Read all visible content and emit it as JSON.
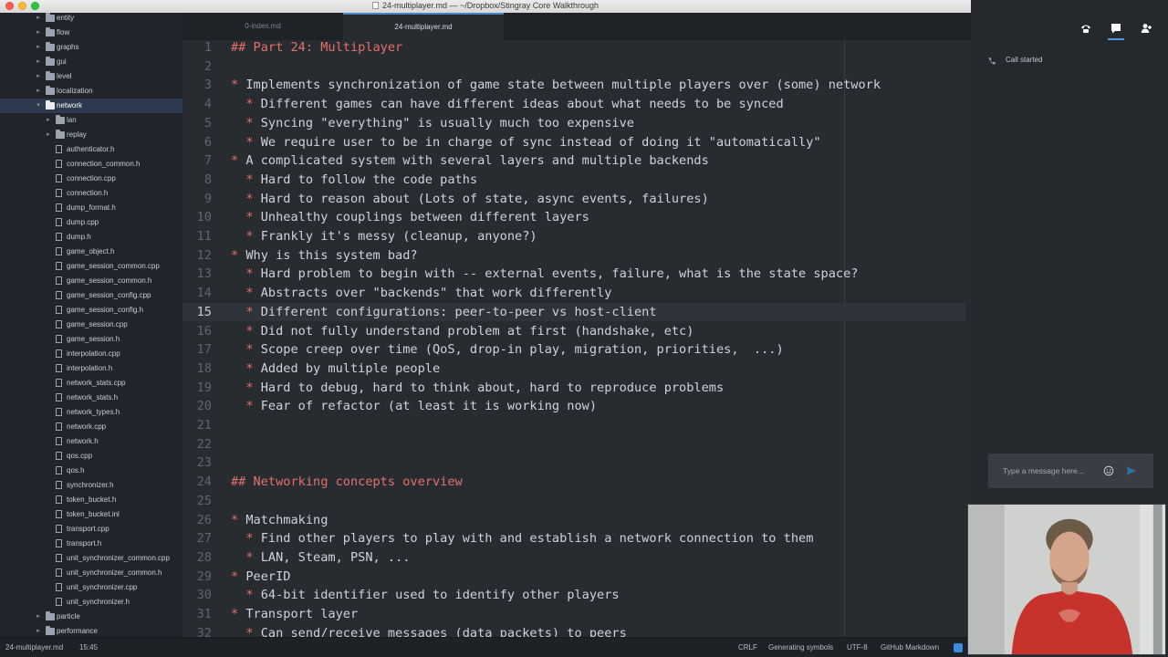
{
  "window": {
    "title": "24-multiplayer.md — ~/Dropbox/Stingray Core Walkthrough"
  },
  "sidebar": {
    "rows": [
      {
        "name": "entity",
        "type": "folder",
        "depth": 1,
        "expanded": false
      },
      {
        "name": "flow",
        "type": "folder",
        "depth": 1,
        "expanded": false
      },
      {
        "name": "graphs",
        "type": "folder",
        "depth": 1,
        "expanded": false
      },
      {
        "name": "gui",
        "type": "folder",
        "depth": 1,
        "expanded": false
      },
      {
        "name": "level",
        "type": "folder",
        "depth": 1,
        "expanded": false
      },
      {
        "name": "localization",
        "type": "folder",
        "depth": 1,
        "expanded": false
      },
      {
        "name": "network",
        "type": "folder",
        "depth": 1,
        "expanded": true,
        "selected": true
      },
      {
        "name": "lan",
        "type": "folder",
        "depth": 2,
        "expanded": false
      },
      {
        "name": "replay",
        "type": "folder",
        "depth": 2,
        "expanded": false
      },
      {
        "name": "authenticator.h",
        "type": "file",
        "depth": 2
      },
      {
        "name": "connection_common.h",
        "type": "file",
        "depth": 2
      },
      {
        "name": "connection.cpp",
        "type": "file",
        "depth": 2
      },
      {
        "name": "connection.h",
        "type": "file",
        "depth": 2
      },
      {
        "name": "dump_format.h",
        "type": "file",
        "depth": 2
      },
      {
        "name": "dump.cpp",
        "type": "file",
        "depth": 2
      },
      {
        "name": "dump.h",
        "type": "file",
        "depth": 2
      },
      {
        "name": "game_object.h",
        "type": "file",
        "depth": 2
      },
      {
        "name": "game_session_common.cpp",
        "type": "file",
        "depth": 2
      },
      {
        "name": "game_session_common.h",
        "type": "file",
        "depth": 2
      },
      {
        "name": "game_session_config.cpp",
        "type": "file",
        "depth": 2
      },
      {
        "name": "game_session_config.h",
        "type": "file",
        "depth": 2
      },
      {
        "name": "game_session.cpp",
        "type": "file",
        "depth": 2
      },
      {
        "name": "game_session.h",
        "type": "file",
        "depth": 2
      },
      {
        "name": "interpolation.cpp",
        "type": "file",
        "depth": 2
      },
      {
        "name": "interpolation.h",
        "type": "file",
        "depth": 2
      },
      {
        "name": "network_stats.cpp",
        "type": "file",
        "depth": 2
      },
      {
        "name": "network_stats.h",
        "type": "file",
        "depth": 2
      },
      {
        "name": "network_types.h",
        "type": "file",
        "depth": 2
      },
      {
        "name": "network.cpp",
        "type": "file",
        "depth": 2
      },
      {
        "name": "network.h",
        "type": "file",
        "depth": 2
      },
      {
        "name": "qos.cpp",
        "type": "file",
        "depth": 2
      },
      {
        "name": "qos.h",
        "type": "file",
        "depth": 2
      },
      {
        "name": "synchronizer.h",
        "type": "file",
        "depth": 2
      },
      {
        "name": "token_bucket.h",
        "type": "file",
        "depth": 2
      },
      {
        "name": "token_bucket.inl",
        "type": "file",
        "depth": 2
      },
      {
        "name": "transport.cpp",
        "type": "file",
        "depth": 2
      },
      {
        "name": "transport.h",
        "type": "file",
        "depth": 2
      },
      {
        "name": "unit_synchronizer_common.cpp",
        "type": "file",
        "depth": 2
      },
      {
        "name": "unit_synchronizer_common.h",
        "type": "file",
        "depth": 2
      },
      {
        "name": "unit_synchronizer.cpp",
        "type": "file",
        "depth": 2
      },
      {
        "name": "unit_synchronizer.h",
        "type": "file",
        "depth": 2
      },
      {
        "name": "particle",
        "type": "folder",
        "depth": 1,
        "expanded": false
      },
      {
        "name": "performance",
        "type": "folder",
        "depth": 1,
        "expanded": false
      }
    ]
  },
  "tabs": [
    {
      "label": "0-index.md",
      "active": false
    },
    {
      "label": "24-multiplayer.md",
      "active": true
    }
  ],
  "editor": {
    "cursor_line": 15,
    "lines": [
      {
        "n": "1",
        "kind": "heading",
        "text": "## Part 24: Multiplayer"
      },
      {
        "n": "2",
        "kind": "blank",
        "text": ""
      },
      {
        "n": "3",
        "kind": "bullet",
        "indent": "",
        "text": "Implements synchronization of game state between multiple players over (some) network"
      },
      {
        "n": "4",
        "kind": "bullet",
        "indent": "  ",
        "text": "Different games can have different ideas about what needs to be synced"
      },
      {
        "n": "5",
        "kind": "bullet",
        "indent": "  ",
        "text": "Syncing \"everything\" is usually much too expensive"
      },
      {
        "n": "6",
        "kind": "bullet",
        "indent": "  ",
        "text": "We require user to be in charge of sync instead of doing it \"automatically\""
      },
      {
        "n": "7",
        "kind": "bullet",
        "indent": "",
        "text": "A complicated system with several layers and multiple backends"
      },
      {
        "n": "8",
        "kind": "bullet",
        "indent": "  ",
        "text": "Hard to follow the code paths"
      },
      {
        "n": "9",
        "kind": "bullet",
        "indent": "  ",
        "text": "Hard to reason about (Lots of state, async events, failures)"
      },
      {
        "n": "10",
        "kind": "bullet",
        "indent": "  ",
        "text": "Unhealthy couplings between different layers"
      },
      {
        "n": "11",
        "kind": "bullet",
        "indent": "  ",
        "text": "Frankly it's messy (cleanup, anyone?)"
      },
      {
        "n": "12",
        "kind": "bullet",
        "indent": "",
        "text": "Why is this system bad?"
      },
      {
        "n": "13",
        "kind": "bullet",
        "indent": "  ",
        "text": "Hard problem to begin with -- external events, failure, what is the state space?"
      },
      {
        "n": "14",
        "kind": "bullet",
        "indent": "  ",
        "text": "Abstracts over \"backends\" that work differently"
      },
      {
        "n": "15",
        "kind": "bullet",
        "indent": "  ",
        "text": "Different configurations: peer-to-peer vs host-client"
      },
      {
        "n": "16",
        "kind": "bullet",
        "indent": "  ",
        "text": "Did not fully understand problem at first (handshake, etc)"
      },
      {
        "n": "17",
        "kind": "bullet",
        "indent": "  ",
        "text": "Scope creep over time (QoS, drop-in play, migration, priorities,  ...)"
      },
      {
        "n": "18",
        "kind": "bullet",
        "indent": "  ",
        "text": "Added by multiple people"
      },
      {
        "n": "19",
        "kind": "bullet",
        "indent": "  ",
        "text": "Hard to debug, hard to think about, hard to reproduce problems"
      },
      {
        "n": "20",
        "kind": "bullet",
        "indent": "  ",
        "text": "Fear of refactor (at least it is working now)"
      },
      {
        "n": "21",
        "kind": "blank",
        "text": ""
      },
      {
        "n": "22",
        "kind": "blank",
        "text": ""
      },
      {
        "n": "23",
        "kind": "blank",
        "text": ""
      },
      {
        "n": "24",
        "kind": "heading",
        "text": "## Networking concepts overview"
      },
      {
        "n": "25",
        "kind": "blank",
        "text": ""
      },
      {
        "n": "26",
        "kind": "bullet",
        "indent": "",
        "text": "Matchmaking"
      },
      {
        "n": "27",
        "kind": "bullet",
        "indent": "  ",
        "text": "Find other players to play with and establish a network connection to them"
      },
      {
        "n": "28",
        "kind": "bullet",
        "indent": "  ",
        "text": "LAN, Steam, PSN, ..."
      },
      {
        "n": "29",
        "kind": "bullet",
        "indent": "",
        "text": "PeerID"
      },
      {
        "n": "30",
        "kind": "bullet",
        "indent": "  ",
        "text": "64-bit identifier used to identify other players"
      },
      {
        "n": "31",
        "kind": "bullet",
        "indent": "",
        "text": "Transport layer"
      },
      {
        "n": "32",
        "kind": "bullet",
        "indent": "  ",
        "text": "Can send/receive messages (data packets) to peers"
      }
    ]
  },
  "status": {
    "file": "24-multiplayer.md",
    "position": "15:45",
    "line_ending": "CRLF",
    "task": "Generating symbols",
    "encoding": "UTF-8",
    "grammar": "GitHub Markdown"
  },
  "call_panel": {
    "log_text": "Call started",
    "message_placeholder": "Type a message here...",
    "accent": "#4a9bdf"
  }
}
